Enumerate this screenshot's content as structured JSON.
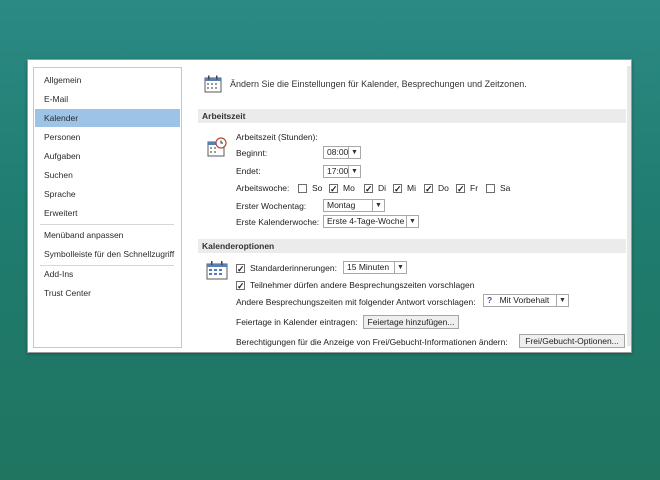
{
  "sidebar": {
    "items": [
      {
        "label": "Allgemein"
      },
      {
        "label": "E-Mail"
      },
      {
        "label": "Kalender"
      },
      {
        "label": "Personen"
      },
      {
        "label": "Aufgaben"
      },
      {
        "label": "Suchen"
      },
      {
        "label": "Sprache"
      },
      {
        "label": "Erweitert"
      },
      {
        "label": "Menüband anpassen"
      },
      {
        "label": "Symbolleiste für den Schnellzugriff"
      },
      {
        "label": "Add-Ins"
      },
      {
        "label": "Trust Center"
      }
    ],
    "selected": "Kalender"
  },
  "header": {
    "text": "Ändern Sie die Einstellungen für Kalender, Besprechungen und Zeitzonen.",
    "icon": "calendar-settings-icon"
  },
  "arbeitszeit": {
    "title": "Arbeitszeit",
    "icon": "clock-calendar-icon",
    "subtitle": "Arbeitszeit (Stunden):",
    "begin_label": "Beginnt:",
    "begin_value": "08:00",
    "end_label": "Endet:",
    "end_value": "17:00",
    "workweek_label": "Arbeitswoche:",
    "days": [
      {
        "label": "So",
        "checked": false
      },
      {
        "label": "Mo",
        "checked": true
      },
      {
        "label": "Di",
        "checked": true
      },
      {
        "label": "Mi",
        "checked": true
      },
      {
        "label": "Do",
        "checked": true
      },
      {
        "label": "Fr",
        "checked": true
      },
      {
        "label": "Sa",
        "checked": false
      }
    ],
    "first_day_label": "Erster Wochentag:",
    "first_day_value": "Montag",
    "first_week_label": "Erste Kalenderwoche:",
    "first_week_value": "Erste 4-Tage-Woche"
  },
  "kalenderoptionen": {
    "title": "Kalenderoptionen",
    "icon": "calendar-grid-icon",
    "reminder_label": "Standarderinnerungen:",
    "reminder_checked": true,
    "reminder_value": "15 Minuten",
    "propose_label": "Teilnehmer dürfen andere Besprechungszeiten vorschlagen",
    "propose_checked": true,
    "response_label": "Andere Besprechungszeiten mit folgender Antwort vorschlagen:",
    "response_value": "Mit Vorbehalt",
    "response_icon": "question-mark-icon",
    "holidays_label": "Feiertage in Kalender eintragen:",
    "holidays_button": "Feiertage hinzufügen...",
    "freebusy_label": "Berechtigungen für die Anzeige von Frei/Gebucht-Informationen ändern:",
    "freebusy_button": "Frei/Gebucht-Optionen..."
  }
}
